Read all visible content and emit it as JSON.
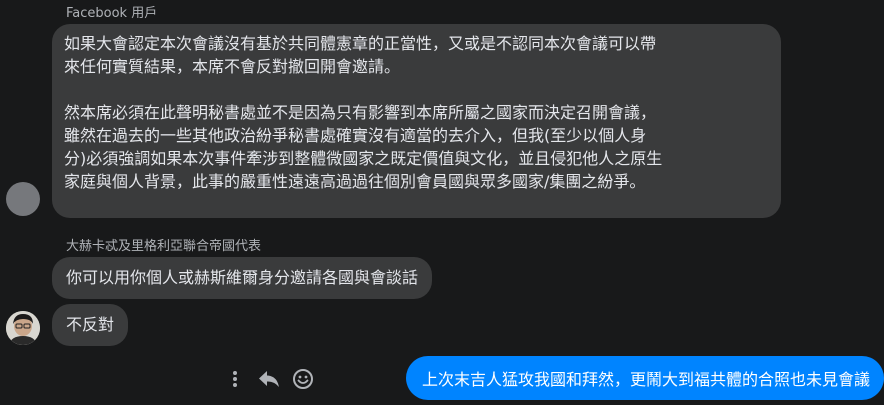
{
  "messages": [
    {
      "sender": "Facebook 用戶",
      "paragraphs": [
        "如果大會認定本次會議沒有基於共同體憲章的正當性，又或是不認同本次會議可以帶\n來任何實質結果，本席不會反對撤回開會邀請。",
        "然本席必須在此聲明秘書處並不是因為只有影響到本席所屬之國家而決定召開會議，\n雖然在過去的一些其他政治紛爭秘書處確實沒有適當的去介入，但我(至少以個人身\n分)必須強調如果本次事件牽涉到整體微國家之既定價值與文化，並且侵犯他人之原生\n家庭與個人背景，此事的嚴重性遠遠高過過往個別會員國與眾多國家/集團之紛爭。"
      ]
    },
    {
      "sender": "大赫卡忒及里格利亞聯合帝國代表",
      "texts": [
        "你可以用你個人或赫斯維爾身分邀請各國與會談話",
        "不反對"
      ]
    }
  ],
  "outgoing": {
    "text": "上次末吉人猛攻我國和拜然，更鬧大到福共體的合照也未見會議"
  },
  "icons": [
    "more-icon",
    "reply-icon",
    "emoji-icon"
  ],
  "colors": {
    "background": "#18191a",
    "bubble_incoming": "#3a3b3c",
    "bubble_outgoing": "#0084ff"
  }
}
